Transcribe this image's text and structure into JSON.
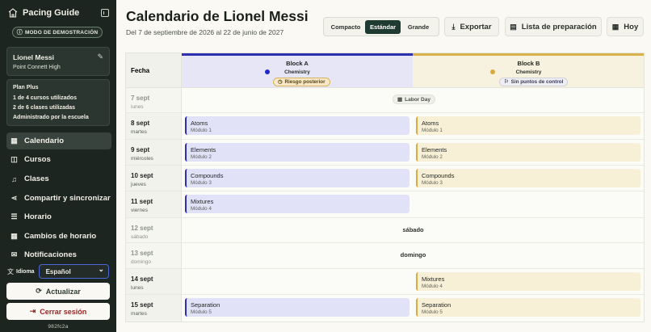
{
  "sidebar": {
    "brand": "Pacing Guide",
    "demo_badge": "MODO DE DEMOSTRACIÓN",
    "user": {
      "name": "Lionel Messi",
      "school": "Point Connett High"
    },
    "plan": {
      "name": "Plan Plus",
      "courses": "1 de 4 cursos utilizados",
      "classes": "2 de 6 clases utilizadas",
      "admin": "Administrado por la escuela"
    },
    "nav": [
      {
        "label": "Calendario",
        "icon": "calendar-icon",
        "active": true
      },
      {
        "label": "Cursos",
        "icon": "book-icon"
      },
      {
        "label": "Clases",
        "icon": "bell-icon"
      },
      {
        "label": "Compartir y sincronizar",
        "icon": "share-icon"
      },
      {
        "label": "Horario",
        "icon": "sliders-icon"
      },
      {
        "label": "Cambios de horario",
        "icon": "calendar-edit-icon"
      },
      {
        "label": "Notificaciones",
        "icon": "mail-icon"
      }
    ],
    "language": {
      "label": "Idioma",
      "value": "Español"
    },
    "refresh_label": "Actualizar",
    "logout_label": "Cerrar sesión",
    "version": "982fc2a"
  },
  "header": {
    "title": "Calendario de Lionel Messi",
    "subtitle": "Del 7 de septiembre de 2026 al 22 de junio de 2027",
    "density": {
      "options": [
        "Compacto",
        "Estándar",
        "Grande"
      ],
      "selected": "Estándar"
    },
    "export_label": "Exportar",
    "prep_label": "Lista de preparación",
    "today_label": "Hoy"
  },
  "grid": {
    "date_header": "Fecha",
    "blocks": [
      {
        "name": "Block A",
        "subject": "Chemistry",
        "pill": "Riesgo posterior",
        "color": "#2b2fb0"
      },
      {
        "name": "Block B",
        "subject": "Chemistry",
        "pill": "Sin puntos de control",
        "color": "#d9ad43"
      }
    ],
    "rows": [
      {
        "date": "7 sept",
        "day": "lunes",
        "holiday": "Labor Day"
      },
      {
        "date": "8 sept",
        "day": "martes",
        "a": {
          "title": "Atoms",
          "module": "Módulo 1"
        },
        "b": {
          "title": "Atoms",
          "module": "Módulo 1"
        }
      },
      {
        "date": "9 sept",
        "day": "miércoles",
        "a": {
          "title": "Elements",
          "module": "Módulo 2"
        },
        "b": {
          "title": "Elements",
          "module": "Módulo 2"
        }
      },
      {
        "date": "10 sept",
        "day": "jueves",
        "a": {
          "title": "Compounds",
          "module": "Módulo 3"
        },
        "b": {
          "title": "Compounds",
          "module": "Módulo 3"
        }
      },
      {
        "date": "11 sept",
        "day": "viernes",
        "a": {
          "title": "Mixtures",
          "module": "Módulo 4"
        }
      },
      {
        "date": "12 sept",
        "day": "sábado",
        "weekend": "sábado"
      },
      {
        "date": "13 sept",
        "day": "domingo",
        "weekend": "domingo"
      },
      {
        "date": "14 sept",
        "day": "lunes",
        "b": {
          "title": "Mixtures",
          "module": "Módulo 4"
        }
      },
      {
        "date": "15 sept",
        "day": "martes",
        "a": {
          "title": "Separation",
          "module": "Módulo 5"
        },
        "b": {
          "title": "Separation",
          "module": "Módulo 5"
        }
      }
    ]
  }
}
